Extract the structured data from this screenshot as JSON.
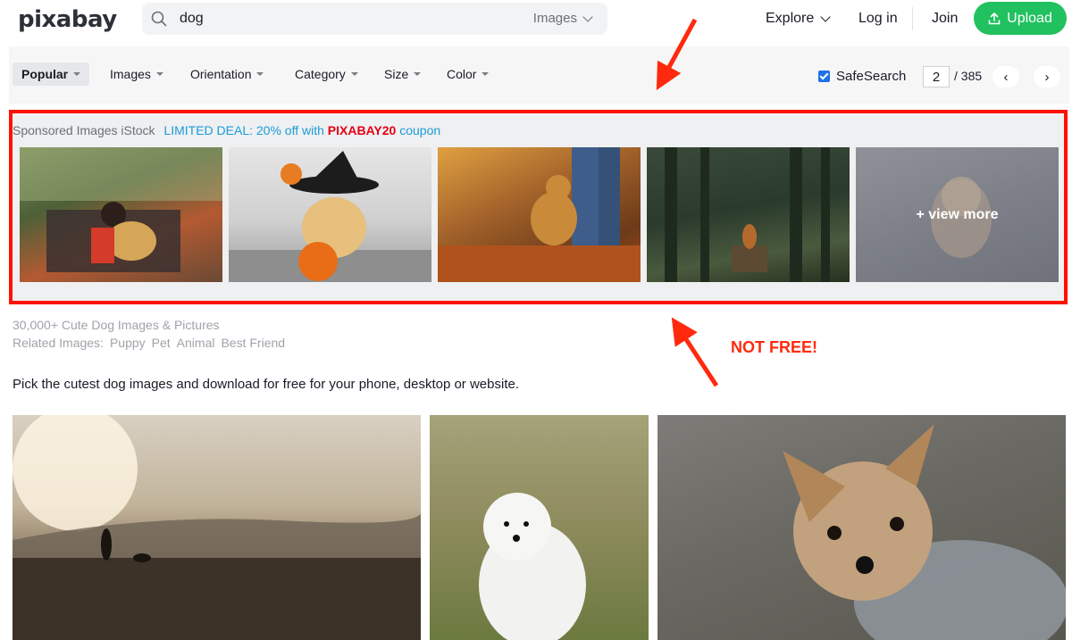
{
  "header": {
    "logo": "pixabay",
    "search_value": "dog",
    "search_type": "Images",
    "explore": "Explore",
    "login": "Log in",
    "join": "Join",
    "upload": "Upload"
  },
  "toolbar": {
    "filters": [
      "Popular",
      "Images",
      "Orientation",
      "Category",
      "Size",
      "Color"
    ],
    "safesearch": "SafeSearch",
    "page_current": "2",
    "page_total": "/ 385",
    "prev": "‹",
    "next": "›"
  },
  "sponsored": {
    "label": "Sponsored Images iStock",
    "deal_prefix": "LIMITED DEAL: 20% off with",
    "deal_code": "PIXABAY20",
    "deal_suffix": "coupon",
    "view_more": "+ view more"
  },
  "annotation": {
    "not_free": "NOT FREE!",
    "color": "#ff2a0e"
  },
  "meta": {
    "count_title": "30,000+ Cute Dog Images & Pictures",
    "related_label": "Related Images:",
    "related_tags": [
      "Puppy",
      "Pet",
      "Animal",
      "Best Friend"
    ],
    "description": "Pick the cutest dog images and download for free for your phone, desktop or website."
  },
  "colors": {
    "accent_green": "#20c15e",
    "sponsored_border": "#ff1100",
    "link_blue": "#1a9cd8",
    "coupon_red": "#e60012"
  }
}
